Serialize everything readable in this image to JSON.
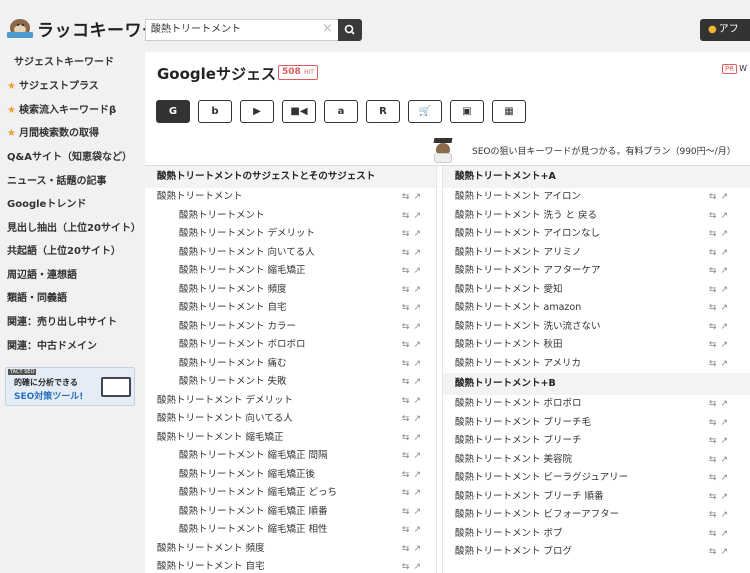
{
  "header": {
    "logo_text": "ラッコキーワード",
    "search_value": "酸熱トリートメント",
    "affiliate_label": "アフ"
  },
  "sidebar": {
    "section_title": "サジェストキーワード",
    "items": [
      {
        "label": "サジェストプラス",
        "star": true
      },
      {
        "label": "検索流入キーワードβ",
        "star": true
      },
      {
        "label": "月間検索数の取得",
        "star": true
      },
      {
        "label": "Q&Aサイト（知恵袋など）",
        "star": false
      },
      {
        "label": "ニュース・話題の記事",
        "star": false
      },
      {
        "label": "Googleトレンド",
        "star": false
      },
      {
        "label": "見出し抽出（上位20サイト）",
        "star": false
      },
      {
        "label": "共起語（上位20サイト）",
        "star": false
      },
      {
        "label": "周辺語・連想語",
        "star": false
      },
      {
        "label": "類語・同義語",
        "star": false
      },
      {
        "label": "関連：売り出し中サイト",
        "star": false
      },
      {
        "label": "関連：中古ドメイン",
        "star": false
      }
    ],
    "banner": {
      "tag": "TACT SEO",
      "line1": "的確に分析できる",
      "line2": "SEO対策ツール!"
    }
  },
  "main": {
    "title": "Googleサジェスト",
    "hit_count": "508",
    "hit_unit": "HIT",
    "pr_label": "PR",
    "pr_text": "W",
    "tools": [
      "G",
      "b",
      "▶",
      "■◀",
      "a",
      "R",
      "🛒",
      "▣",
      "▦"
    ],
    "promo_text": "SEOの狙い目キーワードが見つかる。有料プラン（990円〜/月）",
    "left_column": {
      "header": "酸熱トリートメントのサジェストとそのサジェスト",
      "rows": [
        {
          "text": "酸熱トリートメント",
          "indent": false
        },
        {
          "text": "酸熱トリートメント",
          "indent": true
        },
        {
          "text": "酸熱トリートメント デメリット",
          "indent": true
        },
        {
          "text": "酸熱トリートメント 向いてる人",
          "indent": true
        },
        {
          "text": "酸熱トリートメント 縮毛矯正",
          "indent": true
        },
        {
          "text": "酸熱トリートメント 頻度",
          "indent": true
        },
        {
          "text": "酸熱トリートメント 自宅",
          "indent": true
        },
        {
          "text": "酸熱トリートメント カラー",
          "indent": true
        },
        {
          "text": "酸熱トリートメント ボロボロ",
          "indent": true
        },
        {
          "text": "酸熱トリートメント 痛む",
          "indent": true
        },
        {
          "text": "酸熱トリートメント 失敗",
          "indent": true
        },
        {
          "text": "酸熱トリートメント デメリット",
          "indent": false
        },
        {
          "text": "酸熱トリートメント 向いてる人",
          "indent": false
        },
        {
          "text": "酸熱トリートメント 縮毛矯正",
          "indent": false
        },
        {
          "text": "酸熱トリートメント 縮毛矯正 間隔",
          "indent": true
        },
        {
          "text": "酸熱トリートメント 縮毛矯正後",
          "indent": true
        },
        {
          "text": "酸熱トリートメント 縮毛矯正 どっち",
          "indent": true
        },
        {
          "text": "酸熱トリートメント 縮毛矯正 順番",
          "indent": true
        },
        {
          "text": "酸熱トリートメント 縮毛矯正 相性",
          "indent": true
        },
        {
          "text": "酸熱トリートメント 頻度",
          "indent": false
        },
        {
          "text": "酸熱トリートメント 自宅",
          "indent": false
        }
      ]
    },
    "right_column": {
      "group_a_header": "酸熱トリートメント+A",
      "group_a_rows": [
        "酸熱トリートメント アイロン",
        "酸熱トリートメント 洗う と 戻る",
        "酸熱トリートメント アイロンなし",
        "酸熱トリートメント アリミノ",
        "酸熱トリートメント アフターケア",
        "酸熱トリートメント 愛知",
        "酸熱トリートメント amazon",
        "酸熱トリートメント 洗い流さない",
        "酸熱トリートメント 秋田",
        "酸熱トリートメント アメリカ"
      ],
      "group_b_header": "酸熱トリートメント+B",
      "group_b_rows": [
        "酸熱トリートメント ボロボロ",
        "酸熱トリートメント ブリーチ毛",
        "酸熱トリートメント ブリーチ",
        "酸熱トリートメント 美容院",
        "酸熱トリートメント ビーラグジュアリー",
        "酸熱トリートメント ブリーチ 順番",
        "酸熱トリートメント ビフォーアフター",
        "酸熱トリートメント ボブ",
        "酸熱トリートメント ブログ"
      ]
    }
  }
}
